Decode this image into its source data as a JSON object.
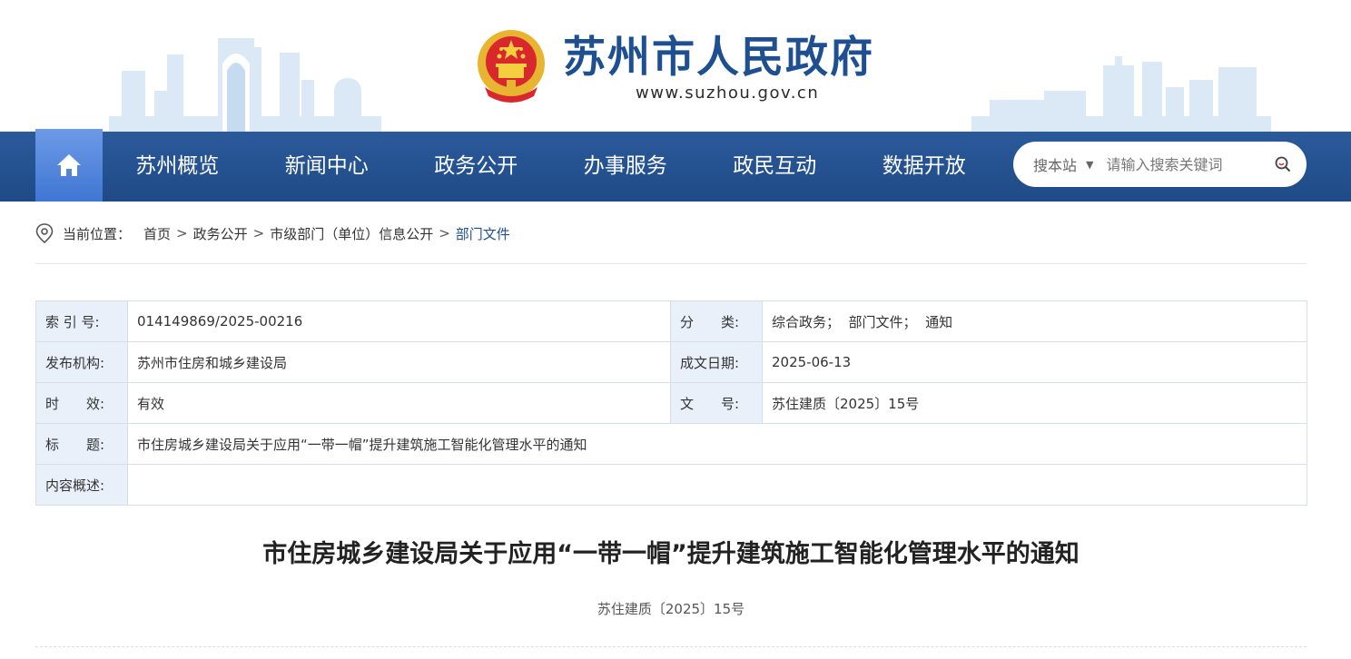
{
  "site": {
    "title": "苏州市人民政府",
    "url": "www.suzhou.gov.cn"
  },
  "nav": {
    "items": [
      "苏州概览",
      "新闻中心",
      "政务公开",
      "办事服务",
      "政民互动",
      "数据开放"
    ]
  },
  "search": {
    "scope": "搜本站",
    "placeholder": "请输入搜索关键词"
  },
  "breadcrumb": {
    "label": "当前位置：",
    "items": [
      "首页",
      "政务公开",
      "市级部门（单位）信息公开",
      "部门文件"
    ],
    "separator": ">"
  },
  "meta": {
    "index_no": {
      "label": "索 引 号:",
      "value": "014149869/2025-00216"
    },
    "category": {
      "label": "分　　类:",
      "value": "综合政务；  部门文件；  通知"
    },
    "publisher": {
      "label": "发布机构:",
      "value": "苏州市住房和城乡建设局"
    },
    "date": {
      "label": "成文日期:",
      "value": "2025-06-13"
    },
    "validity": {
      "label": "时　　效:",
      "value": "有效"
    },
    "doc_no": {
      "label": "文　　号:",
      "value": "苏住建质〔2025〕15号"
    },
    "title": {
      "label": "标　　题:",
      "value": "市住房城乡建设局关于应用“一带一帽”提升建筑施工智能化管理水平的通知"
    },
    "summary": {
      "label": "内容概述:",
      "value": ""
    }
  },
  "document": {
    "title": "市住房城乡建设局关于应用“一带一帽”提升建筑施工智能化管理水平的通知",
    "number": "苏住建质〔2025〕15号"
  },
  "colors": {
    "brand": "#1d4f91",
    "nav_bg": "#24508f",
    "nav_home": "#5b8ce0",
    "table_label_bg": "#e9f0fa"
  },
  "icons": {
    "home": "home-icon",
    "search": "search-icon",
    "location": "location-pin-icon",
    "emblem": "national-emblem-icon"
  }
}
